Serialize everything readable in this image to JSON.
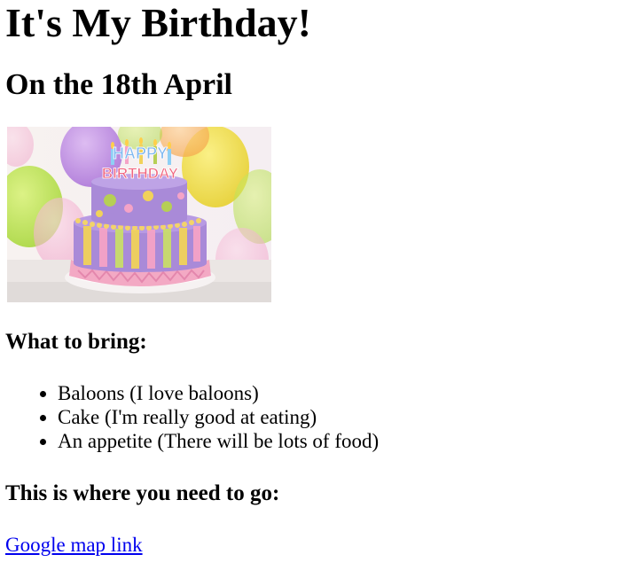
{
  "page": {
    "heading": "It's My Birthday!",
    "subheading": "On the 18th April",
    "image": {
      "cake_topper_line1": "HAPPY",
      "cake_topper_line2": "BIRTHDAY"
    },
    "bring_heading": "What to bring:",
    "bring_items": [
      "Baloons (I love baloons)",
      "Cake (I'm really good at eating)",
      "An appetite (There will be lots of food)"
    ],
    "where_heading": "This is where you need to go:",
    "map_link_text": "Google map link"
  },
  "colors": {
    "link": "#0000ee",
    "text": "#000000",
    "background": "#ffffff"
  }
}
